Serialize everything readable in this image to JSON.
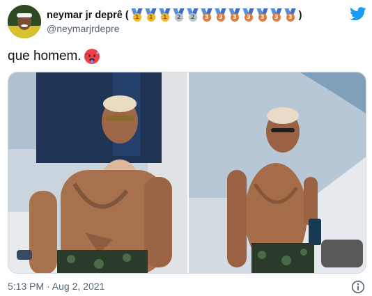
{
  "author": {
    "display_name": "neymar jr deprê (",
    "medals": [
      {
        "digit": "1",
        "kind": "gold"
      },
      {
        "digit": "1",
        "kind": "gold"
      },
      {
        "digit": "1",
        "kind": "gold"
      },
      {
        "digit": "2",
        "kind": "silver"
      },
      {
        "digit": "2",
        "kind": "silver"
      },
      {
        "digit": "3",
        "kind": "bronze"
      },
      {
        "digit": "3",
        "kind": "bronze"
      },
      {
        "digit": "3",
        "kind": "bronze"
      },
      {
        "digit": "3",
        "kind": "bronze"
      },
      {
        "digit": "3",
        "kind": "bronze"
      },
      {
        "digit": "3",
        "kind": "bronze"
      },
      {
        "digit": "3",
        "kind": "bronze"
      }
    ],
    "display_name_close": ")",
    "handle": "@neymarjrdepre",
    "avatar_icon": "profile-avatar"
  },
  "tweet": {
    "text": "que homem.",
    "emoji": "hot-face-emoji"
  },
  "media": {
    "count": 2,
    "photos": [
      "photo-left",
      "photo-right"
    ]
  },
  "footer": {
    "timestamp": "5:13 PM · Aug 2, 2021",
    "info_icon": "info-icon"
  },
  "colors": {
    "brand_blue": "#1d9bf0",
    "text_primary": "#0f1419",
    "text_secondary": "#536471",
    "border": "#cfd9de"
  }
}
